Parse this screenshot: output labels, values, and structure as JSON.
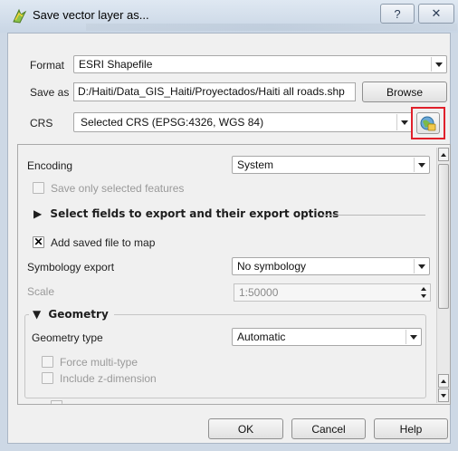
{
  "window": {
    "title": "Save vector layer as...",
    "help_glyph": "?",
    "close_glyph": "✕"
  },
  "form": {
    "format_label": "Format",
    "format_value": "ESRI Shapefile",
    "saveas_label": "Save as",
    "saveas_value": "D:/Haiti/Data_GIS_Haiti/Proyectados/Haiti all roads.shp",
    "browse_label": "Browse",
    "crs_label": "CRS",
    "crs_value": "Selected CRS (EPSG:4326, WGS 84)"
  },
  "options": {
    "encoding_label": "Encoding",
    "encoding_value": "System",
    "save_selected_label": "Save only selected features",
    "select_fields_label": "Select fields to export and their export options",
    "add_to_map_label": "Add saved file to map",
    "add_to_map_checked": true,
    "add_to_map_mark": "✕",
    "symbology_label": "Symbology export",
    "symbology_value": "No symbology",
    "scale_label": "Scale",
    "scale_value": "1:50000",
    "geometry_title": "Geometry",
    "geometry_type_label": "Geometry type",
    "geometry_type_value": "Automatic",
    "force_multi_label": "Force multi-type",
    "include_z_label": "Include z-dimension"
  },
  "buttons": {
    "ok": "OK",
    "cancel": "Cancel",
    "help": "Help"
  },
  "colors": {
    "highlight": "#e0202a",
    "title_bg": "#dfe8f2"
  }
}
